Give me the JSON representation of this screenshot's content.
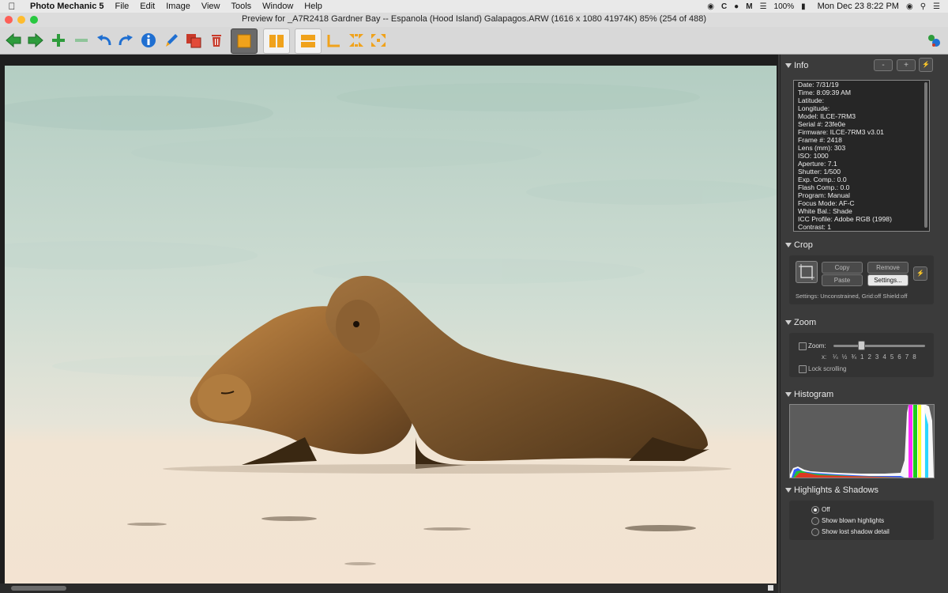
{
  "menubar": {
    "app_name": "Photo Mechanic 5",
    "items": [
      "File",
      "Edit",
      "Image",
      "View",
      "Tools",
      "Window",
      "Help"
    ],
    "battery": "100%",
    "datetime": "Mon Dec 23  8:22 PM"
  },
  "window": {
    "title": "Preview for _A7R2418 Gardner Bay -- Espanola (Hood Island)  Galapagos.ARW (1616 x 1080 41974K) 85% (254 of 488)"
  },
  "colors": {
    "accent": "#f0a21b",
    "green": "#2e9c3c",
    "blue": "#1f6fd1",
    "red": "#c83a2a"
  },
  "sidebar": {
    "info": {
      "title": "Info",
      "btn_minus": "-",
      "btn_plus": "+",
      "rows": [
        "Date: 7/31/19",
        "Time: 8:09:39 AM",
        "Latitude:",
        "Longitude:",
        "Model: ILCE-7RM3",
        "Serial #: 23fe0e",
        "Firmware: ILCE-7RM3 v3.01",
        "Frame #: 2418",
        "Lens (mm): 303",
        "ISO: 1000",
        "Aperture: 7.1",
        "Shutter: 1/500",
        "Exp. Comp.: 0.0",
        "Flash Comp.: 0.0",
        "Program: Manual",
        "Focus Mode: AF-C",
        "White Bal.: Shade",
        "ICC Profile: Adobe RGB (1998)",
        "Contrast: 1"
      ]
    },
    "crop": {
      "title": "Crop",
      "copy": "Copy",
      "remove": "Remove",
      "paste": "Paste",
      "settings": "Settings...",
      "settings_text": "Settings:   Unconstrained, Grid:off Shield:off"
    },
    "zoom": {
      "title": "Zoom",
      "label": "Zoom:",
      "x_label": "x:",
      "marks": [
        "¼",
        "½",
        "¾",
        "1",
        "2",
        "3",
        "4",
        "5",
        "6",
        "7",
        "8"
      ],
      "lock": "Lock scrolling"
    },
    "histogram": {
      "title": "Histogram"
    },
    "highlights": {
      "title": "Highlights & Shadows",
      "options": [
        "Off",
        "Show blown highlights",
        "Show lost shadow detail"
      ],
      "selected": 0
    }
  }
}
